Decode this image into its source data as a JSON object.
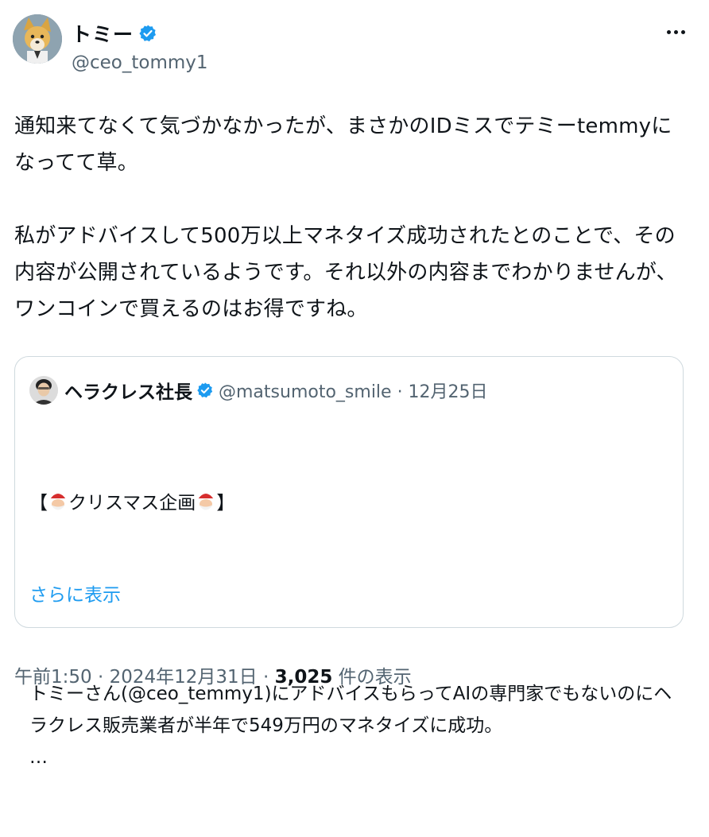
{
  "author": {
    "display_name": "トミー",
    "handle": "@ceo_tommy1",
    "verified_icon": "verified-badge-icon"
  },
  "tweet": {
    "text": "通知来てなくて気づかなかったが、まさかのIDミスでテミーtemmyになってて草。\n\n私がアドバイスして500万以上マネタイズ成功されたとのことで、その内容が公開されているようです。それ以外の内容までわかりませんが、ワンコインで買えるのはお得ですね。"
  },
  "quote": {
    "display_name": "ヘラクレス社長",
    "meta": "@matsumoto_smile · 12月25日",
    "title_open": "【",
    "title_text": "クリスマス企画",
    "title_close": "】",
    "emoji": "santa-emoji",
    "body": "トミーさん(@ceo_temmy1)にアドバイスもらってAIの専門家でもないのにヘラクレス販売業者が半年で549万円のマネタイズに成功。\n…",
    "show_more": "さらに表示"
  },
  "footer": {
    "time": "午前1:50 · 2024年12月31日 · ",
    "views": "3,025",
    "views_label": " 件の表示"
  },
  "colors": {
    "link": "#1d9bf0",
    "muted": "#536471",
    "text": "#0f1419",
    "border": "#cfd9de"
  }
}
